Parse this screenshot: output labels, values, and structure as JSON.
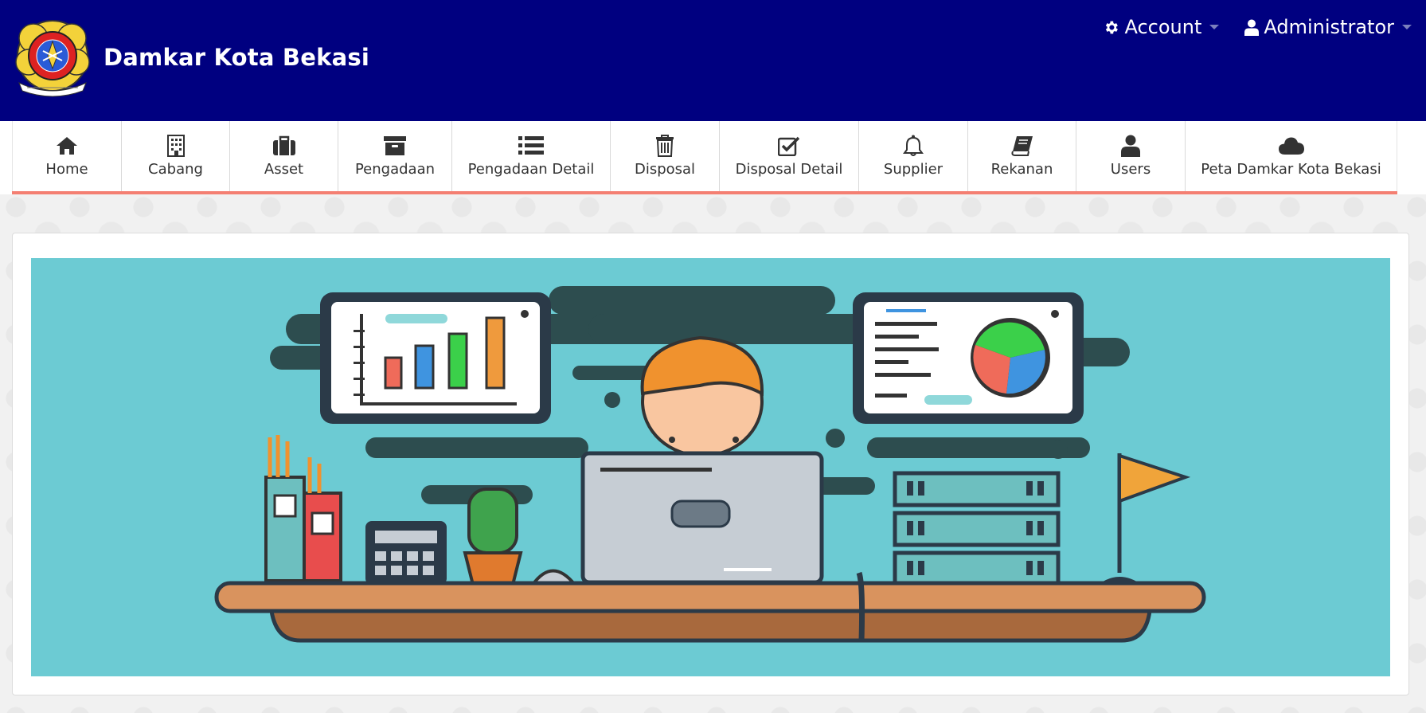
{
  "header": {
    "brand_title": "Damkar Kota Bekasi",
    "logo_icon": "damkar-emblem-logo",
    "menu": [
      {
        "label": "Account",
        "icon": "gear-icon"
      },
      {
        "label": "Administrator",
        "icon": "user-icon"
      }
    ]
  },
  "nav": {
    "items": [
      {
        "label": "Home",
        "icon": "home-icon"
      },
      {
        "label": "Cabang",
        "icon": "building-icon"
      },
      {
        "label": "Asset",
        "icon": "briefcase-icon"
      },
      {
        "label": "Pengadaan",
        "icon": "archive-icon"
      },
      {
        "label": "Pengadaan Detail",
        "icon": "list-icon"
      },
      {
        "label": "Disposal",
        "icon": "trash-icon"
      },
      {
        "label": "Disposal Detail",
        "icon": "check-square-icon"
      },
      {
        "label": "Supplier",
        "icon": "bell-icon"
      },
      {
        "label": "Rekanan",
        "icon": "book-icon"
      },
      {
        "label": "Users",
        "icon": "user-icon"
      },
      {
        "label": "Peta Damkar Kota Bekasi",
        "icon": "cloud-icon"
      }
    ]
  },
  "colors": {
    "header_bg": "#000080",
    "nav_accent": "#f47f72",
    "hero_bg": "#6ccbd3"
  },
  "hero": {
    "illustration": "developer-workspace-illustration"
  }
}
